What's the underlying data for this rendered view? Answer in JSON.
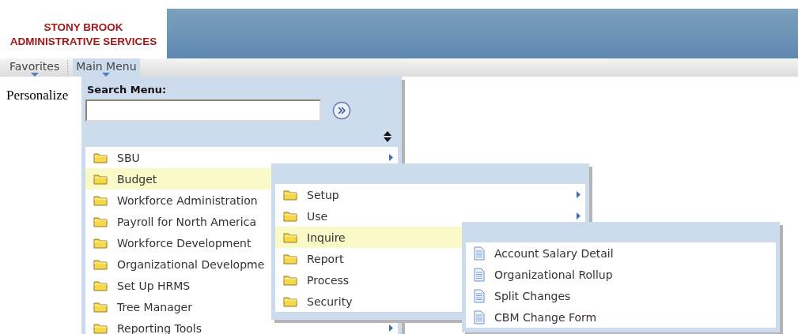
{
  "header": {
    "logo_lines": [
      "STONY BROOK",
      "ADMINISTRATIVE SERVICES"
    ]
  },
  "menubar": [
    {
      "label": "Favorites",
      "selected": false
    },
    {
      "label": "Main Menu",
      "selected": true
    }
  ],
  "page_text": "Personalize",
  "main_menu": {
    "search_label": "Search Menu:",
    "items": [
      {
        "label": "SBU",
        "kind": "folder",
        "selected": false,
        "submenu": true
      },
      {
        "label": "Budget",
        "kind": "folder",
        "selected": true,
        "submenu": false
      },
      {
        "label": "Workforce Administration",
        "kind": "folder",
        "selected": false,
        "submenu": false
      },
      {
        "label": "Payroll for North America",
        "kind": "folder",
        "selected": false,
        "submenu": false
      },
      {
        "label": "Workforce Development",
        "kind": "folder",
        "selected": false,
        "submenu": false
      },
      {
        "label": "Organizational Developme",
        "kind": "folder",
        "selected": false,
        "submenu": false
      },
      {
        "label": "Set Up HRMS",
        "kind": "folder",
        "selected": false,
        "submenu": false
      },
      {
        "label": "Tree Manager",
        "kind": "folder",
        "selected": false,
        "submenu": false
      },
      {
        "label": "Reporting Tools",
        "kind": "folder",
        "selected": false,
        "submenu": true
      }
    ]
  },
  "submenus": [
    {
      "items": [
        {
          "label": "Setup",
          "kind": "folder",
          "selected": false,
          "submenu": true
        },
        {
          "label": "Use",
          "kind": "folder",
          "selected": false,
          "submenu": true
        },
        {
          "label": "Inquire",
          "kind": "folder",
          "selected": true,
          "submenu": false
        },
        {
          "label": "Report",
          "kind": "folder",
          "selected": false,
          "submenu": false
        },
        {
          "label": "Process",
          "kind": "folder",
          "selected": false,
          "submenu": false
        },
        {
          "label": "Security",
          "kind": "folder",
          "selected": false,
          "submenu": false
        }
      ]
    },
    {
      "items": [
        {
          "label": "Account Salary Detail",
          "kind": "page",
          "selected": false,
          "submenu": false
        },
        {
          "label": "Organizational Rollup",
          "kind": "page",
          "selected": false,
          "submenu": false
        },
        {
          "label": "Split Changes",
          "kind": "page",
          "selected": false,
          "submenu": false
        },
        {
          "label": "CBM Change Form",
          "kind": "page",
          "selected": false,
          "submenu": false
        }
      ]
    }
  ]
}
